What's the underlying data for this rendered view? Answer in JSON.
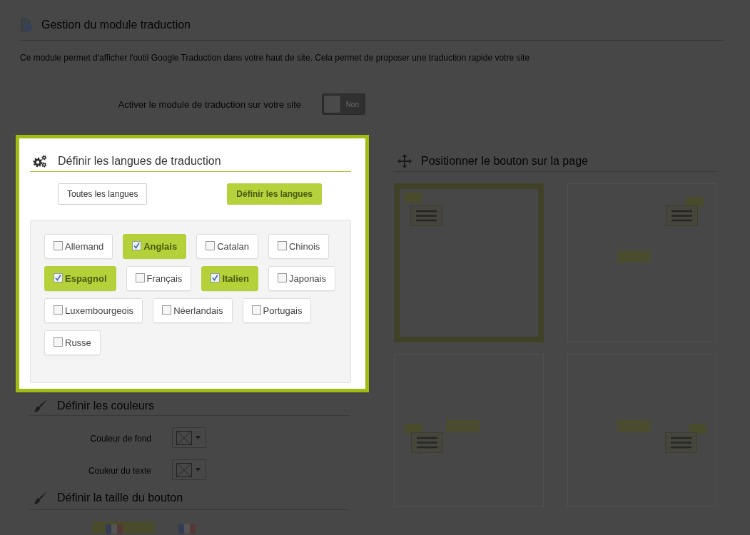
{
  "header": {
    "title": "Gestion du module traduction",
    "description": "Ce module permet d'afficher l'outil Google Traduction dans votre haut de site. Cela permet de proposer une traduction rapide votre site"
  },
  "activation": {
    "label": "Activer le module de traduction sur votre site",
    "on": false,
    "state_text": "Non"
  },
  "languages_panel": {
    "title": "Définir les langues de traduction",
    "modes": [
      {
        "label": "Toutes les langues",
        "selected": false
      },
      {
        "label": "Définir les langues",
        "selected": true
      }
    ],
    "languages": [
      {
        "label": "Allemand",
        "checked": false
      },
      {
        "label": "Anglais",
        "checked": true
      },
      {
        "label": "Catalan",
        "checked": false
      },
      {
        "label": "Chinois",
        "checked": false
      },
      {
        "label": "Espagnol",
        "checked": true
      },
      {
        "label": "Français",
        "checked": false
      },
      {
        "label": "Italien",
        "checked": true
      },
      {
        "label": "Japonais",
        "checked": false
      },
      {
        "label": "Luxembourgeois",
        "checked": false
      },
      {
        "label": "Néerlandais",
        "checked": false
      },
      {
        "label": "Portugais",
        "checked": false
      },
      {
        "label": "Russe",
        "checked": false
      }
    ]
  },
  "position_panel": {
    "title": "Positionner le bouton sur la page",
    "options": [
      {
        "selected": true
      },
      {
        "selected": false
      },
      {
        "selected": false
      },
      {
        "selected": false
      }
    ]
  },
  "colors_panel": {
    "title": "Définir les couleurs",
    "fields": [
      {
        "label": "Couleur de fond"
      },
      {
        "label": "Couleur du texte"
      }
    ]
  },
  "size_panel": {
    "title": "Définir la taille du bouton",
    "options": [
      {
        "selected": true
      },
      {
        "selected": false
      }
    ]
  }
}
